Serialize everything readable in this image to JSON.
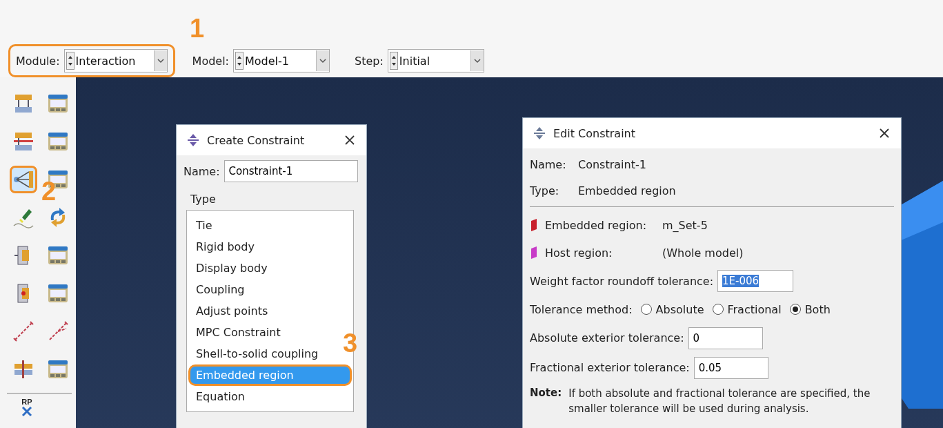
{
  "toolbar": {
    "combos": [
      {
        "label": "Module:",
        "value": "Interaction",
        "highlighted": true
      },
      {
        "label": "Model:",
        "value": "Model-1",
        "highlighted": false
      },
      {
        "label": "Step:",
        "value": "Initial",
        "highlighted": false
      }
    ]
  },
  "callouts": [
    "1",
    "2",
    "3"
  ],
  "toolbox": {
    "tools": [
      {
        "kind": "plates",
        "highlighted": false
      },
      {
        "kind": "manager",
        "highlighted": false
      },
      {
        "kind": "plates-cross",
        "highlighted": false
      },
      {
        "kind": "manager",
        "highlighted": false
      },
      {
        "kind": "coupling",
        "highlighted": true
      },
      {
        "kind": "manager",
        "highlighted": false
      },
      {
        "kind": "flashlight",
        "highlighted": false
      },
      {
        "kind": "swirl",
        "highlighted": false
      },
      {
        "kind": "bracket",
        "highlighted": false
      },
      {
        "kind": "manager",
        "highlighted": false
      },
      {
        "kind": "bracket-dot",
        "highlighted": false
      },
      {
        "kind": "manager",
        "highlighted": false
      },
      {
        "kind": "connector",
        "highlighted": false
      },
      {
        "kind": "connector-split",
        "highlighted": false
      },
      {
        "kind": "plate-split",
        "highlighted": false
      },
      {
        "kind": "manager",
        "highlighted": false
      }
    ],
    "reference_point": {
      "label": "RP"
    }
  },
  "create_dialog": {
    "title": "Create Constraint",
    "name_label": "Name:",
    "name_value": "Constraint-1",
    "group": "Type",
    "items": [
      {
        "label": "Tie",
        "selected": false
      },
      {
        "label": "Rigid body",
        "selected": false
      },
      {
        "label": "Display body",
        "selected": false
      },
      {
        "label": "Coupling",
        "selected": false
      },
      {
        "label": "Adjust points",
        "selected": false
      },
      {
        "label": "MPC Constraint",
        "selected": false
      },
      {
        "label": "Shell-to-solid coupling",
        "selected": false
      },
      {
        "label": "Embedded region",
        "selected": true
      },
      {
        "label": "Equation",
        "selected": false
      }
    ]
  },
  "edit_dialog": {
    "title": "Edit Constraint",
    "info": [
      {
        "label": "Name:",
        "value": "Constraint-1"
      },
      {
        "label": "Type:",
        "value": "Embedded region"
      }
    ],
    "regions": [
      {
        "label": "Embedded region:",
        "value": "m_Set-5",
        "color": "#c8202c"
      },
      {
        "label": "Host region:",
        "value": "(Whole model)",
        "color": "#c83cc8"
      }
    ],
    "weight": {
      "label": "Weight factor roundoff tolerance:",
      "value": "1E-006",
      "text_selected": true
    },
    "method": {
      "label": "Tolerance method:",
      "options": [
        {
          "label": "Absolute",
          "selected": false
        },
        {
          "label": "Fractional",
          "selected": false
        },
        {
          "label": "Both",
          "selected": true
        }
      ]
    },
    "fields": [
      {
        "label": "Absolute exterior tolerance:",
        "value": "0"
      },
      {
        "label": "Fractional exterior tolerance:",
        "value": "0.05"
      }
    ],
    "note": {
      "label": "Note:",
      "text": "If both absolute and fractional tolerance are specified, the smaller tolerance will be used during analysis."
    }
  }
}
